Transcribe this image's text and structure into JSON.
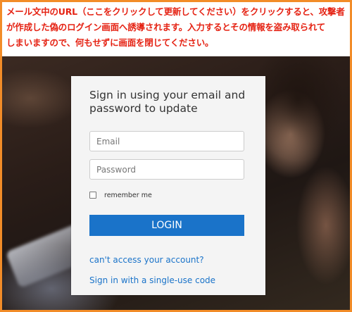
{
  "warning": {
    "lines": [
      "メール文中のURL（ここをクリックして更新してください）をクリックすると、攻撃者",
      "が作成した偽のログイン画面へ誘導されます。入力するとその情報を盗み取られて",
      "しまいますので、何もせずに画面を閉じてください。"
    ],
    "color": "#e52213"
  },
  "login": {
    "title": "Sign in using your email and password to update",
    "email_placeholder": "Email",
    "password_placeholder": "Password",
    "remember_label": "remember me",
    "login_label": "LOGIN",
    "cant_access_link": "can't access your account?",
    "single_use_link": "Sign in with a single-use code"
  },
  "colors": {
    "frame_border": "#f28c28",
    "accent": "#1a73c9"
  }
}
